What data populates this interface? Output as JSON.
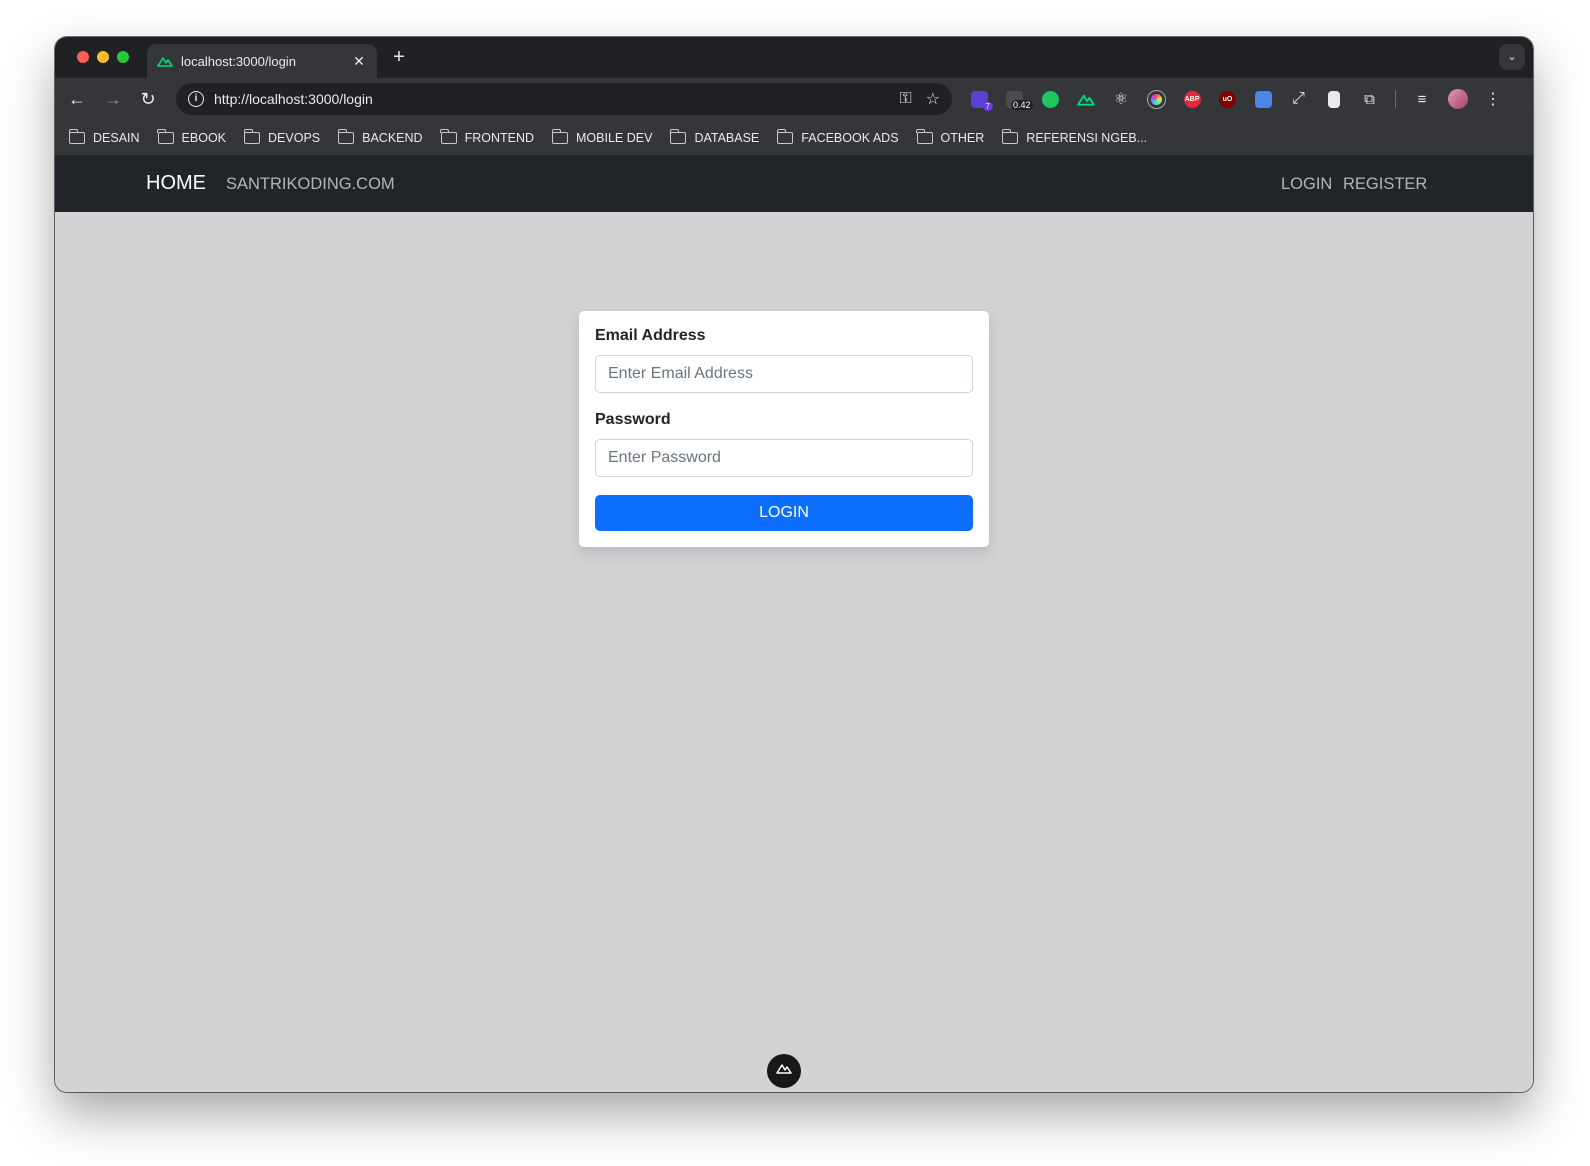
{
  "browser": {
    "tab": {
      "title": "localhost:3000/login"
    },
    "address_bar": {
      "url": "http://localhost:3000/login"
    },
    "extensions": {
      "badge_count": "7",
      "badge_value": "0.42",
      "abp_label": "ABP",
      "ublock_label": "uO"
    },
    "bookmarks": [
      {
        "label": "DESAIN"
      },
      {
        "label": "EBOOK"
      },
      {
        "label": "DEVOPS"
      },
      {
        "label": "BACKEND"
      },
      {
        "label": "FRONTEND"
      },
      {
        "label": "MOBILE DEV"
      },
      {
        "label": "DATABASE"
      },
      {
        "label": "FACEBOOK ADS"
      },
      {
        "label": "OTHER"
      },
      {
        "label": "REFERENSI NGEB..."
      }
    ]
  },
  "navbar": {
    "brand": "HOME",
    "site_link": "SANTRIKODING.COM",
    "login_link": "LOGIN",
    "register_link": "REGISTER"
  },
  "form": {
    "email_label": "Email Address",
    "email_placeholder": "Enter Email Address",
    "password_label": "Password",
    "password_placeholder": "Enter Password",
    "submit_label": "LOGIN"
  },
  "colors": {
    "navbar_bg": "#212529",
    "button_bg": "#0d6efd",
    "page_bg": "#d3d3d6"
  }
}
